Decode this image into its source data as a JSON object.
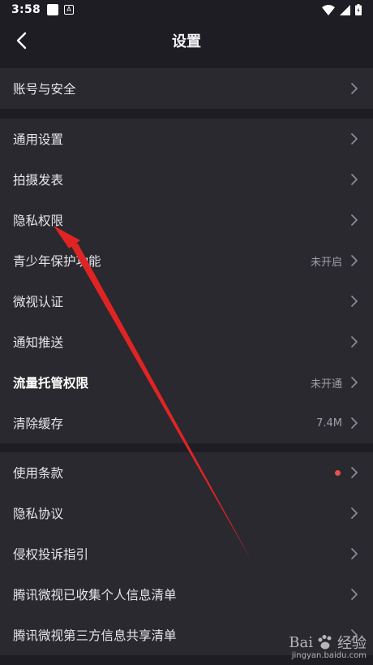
{
  "status": {
    "time": "3:58",
    "icon_a": "A"
  },
  "header": {
    "title": "设置"
  },
  "section1": [
    {
      "label": "账号与安全",
      "value": "",
      "dot": false,
      "bold": false
    }
  ],
  "section2": [
    {
      "label": "通用设置",
      "value": "",
      "dot": false,
      "bold": false
    },
    {
      "label": "拍摄发表",
      "value": "",
      "dot": false,
      "bold": false
    },
    {
      "label": "隐私权限",
      "value": "",
      "dot": false,
      "bold": false
    },
    {
      "label": "青少年保护功能",
      "value": "未开启",
      "dot": false,
      "bold": false
    },
    {
      "label": "微视认证",
      "value": "",
      "dot": false,
      "bold": false
    },
    {
      "label": "通知推送",
      "value": "",
      "dot": false,
      "bold": false
    },
    {
      "label": "流量托管权限",
      "value": "未开通",
      "dot": false,
      "bold": true
    },
    {
      "label": "清除缓存",
      "value": "7.4M",
      "dot": false,
      "bold": false
    }
  ],
  "section3": [
    {
      "label": "使用条款",
      "value": "",
      "dot": true,
      "bold": false
    },
    {
      "label": "隐私协议",
      "value": "",
      "dot": false,
      "bold": false
    },
    {
      "label": "侵权投诉指引",
      "value": "",
      "dot": false,
      "bold": false
    },
    {
      "label": "腾讯微视已收集个人信息清单",
      "value": "",
      "dot": false,
      "bold": false
    },
    {
      "label": "腾讯微视第三方信息共享清单",
      "value": "",
      "dot": false,
      "bold": false
    }
  ],
  "watermark": {
    "brand": "Bai",
    "brand2": "经验",
    "url": "jingyan.baidu.com"
  },
  "colors": {
    "background": "#1e1d23",
    "section": "#2a292f",
    "accent_dot": "#e8504c",
    "annotation_arrow": "#e02424"
  },
  "icons": {
    "back": "chevron-left-icon",
    "row": "chevron-right-icon"
  }
}
